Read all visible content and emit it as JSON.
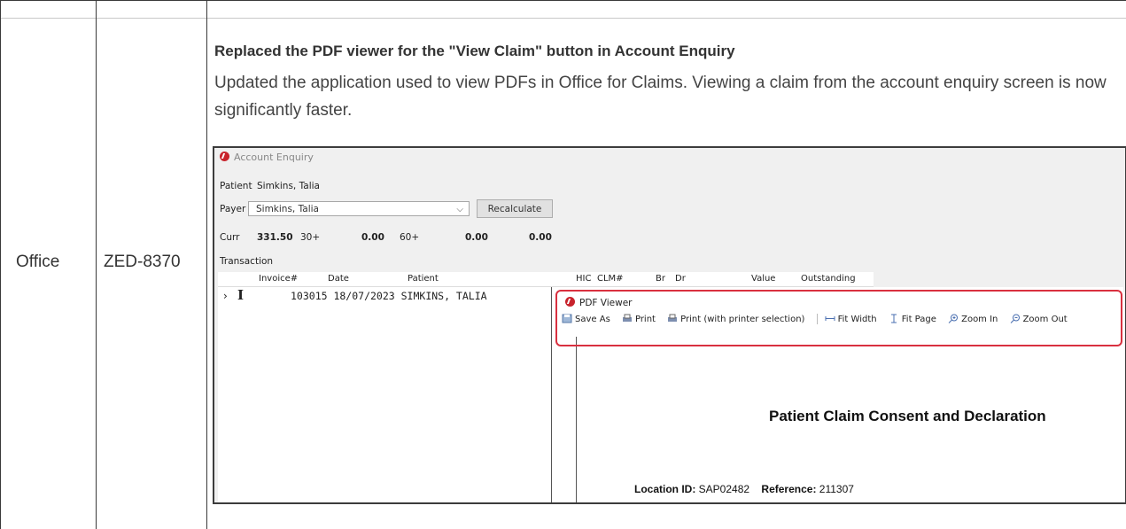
{
  "row": {
    "product": "Office",
    "ticket": "ZED-8370",
    "title": "Replaced the PDF viewer for the \"View Claim\" button in Account Enquiry",
    "description": "Updated the application used to view PDFs in Office for Claims. Viewing a claim from the account enquiry screen is now significantly faster."
  },
  "screenshot": {
    "window_title": "Account Enquiry",
    "patient_label": "Patient",
    "patient_value": "Simkins, Talia",
    "payer_label": "Payer",
    "payer_value": "Simkins, Talia",
    "recalculate_label": "Recalculate",
    "curr_label": "Curr",
    "curr_value": "331.50",
    "b30_label": "30+",
    "b30_value": "0.00",
    "b60_label": "60+",
    "b60_value": "0.00",
    "b90_value": "0.00",
    "transaction_label": "Transaction",
    "columns": [
      "Invoice#",
      "Date",
      "Patient",
      "HIC",
      "CLM#",
      "Br",
      "Dr",
      "Value",
      "Outstanding"
    ],
    "row_text": "103015 18/07/2023 SIMKINS, TALIA",
    "pdf_viewer": {
      "title": "PDF Viewer",
      "toolbar": [
        "Save As",
        "Print",
        "Print (with printer selection)",
        "Fit Width",
        "Fit Page",
        "Zoom In",
        "Zoom Out"
      ],
      "doc_title": "Patient Claim Consent and Declaration",
      "location_label": "Location ID:",
      "location_value": "SAP02482",
      "reference_label": "Reference:",
      "reference_value": "211307"
    },
    "colors": {
      "brand": "#c8232c",
      "highlight": "#d9303f"
    }
  }
}
